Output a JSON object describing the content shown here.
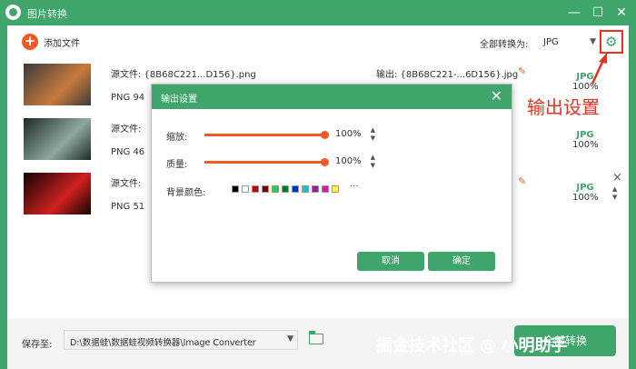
{
  "window": {
    "title": "图片转换"
  },
  "toolbar": {
    "add_label": "添加文件",
    "convert_all_label": "全部转换为:",
    "format_value": "JPG"
  },
  "files": [
    {
      "source": "源文件: {8B68C221...D156}.png",
      "meta": "PNG  94",
      "output": "输出: {8B68C221-...6D156}.jpg",
      "format": "JPG",
      "quality": "100%",
      "thumb_colors": [
        "#3a3a3a",
        "#c97a3c"
      ]
    },
    {
      "source": "源文件:",
      "meta": "PNG  46",
      "output": "",
      "format": "JPG",
      "quality": "100%",
      "thumb_colors": [
        "#1d2a24",
        "#8fa9a0"
      ]
    },
    {
      "source": "源文件:",
      "meta": "PNG  51",
      "output": "",
      "format": "JPG",
      "quality": "100%",
      "thumb_colors": [
        "#120505",
        "#d02020"
      ]
    }
  ],
  "dialog": {
    "title": "输出设置",
    "scale_label": "缩放:",
    "scale_value": "100%",
    "scale_fraction": 1.0,
    "quality_label": "质量:",
    "quality_value": "100%",
    "quality_fraction": 1.0,
    "bg_label": "背景颜色:",
    "colors": [
      "#000000",
      "#ffffff",
      "#c00000",
      "#7b0000",
      "#2ecc40",
      "#007a1f",
      "#0033cc",
      "#1cc0c0",
      "#8a1fa8",
      "#e0189a",
      "#ffff33"
    ],
    "more": "···",
    "cancel": "取消",
    "confirm": "确定"
  },
  "footer": {
    "save_label": "保存至:",
    "path": "D:\\数据蛙\\数据蛙视频转换器\\Image Converter",
    "convert_button": "全部转换"
  },
  "annotation": {
    "label": "输出设置"
  },
  "watermark": "掘金技术社区 @ 小明助手",
  "accent_color": "#3fa56a"
}
